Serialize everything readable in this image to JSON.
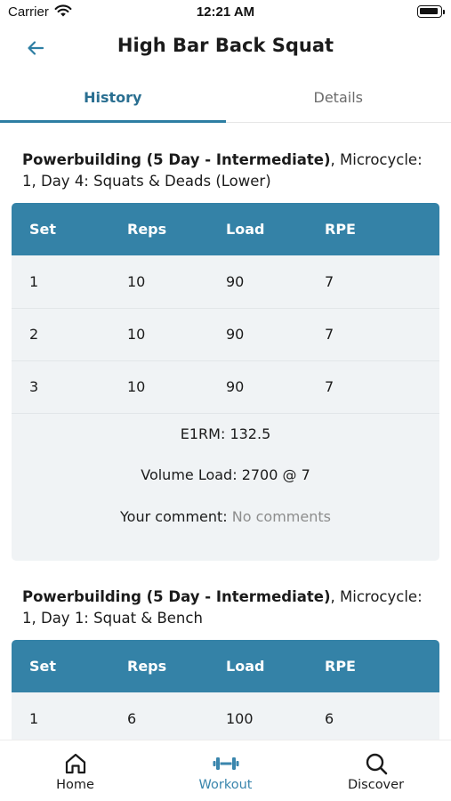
{
  "status_bar": {
    "carrier": "Carrier",
    "time": "12:21 AM"
  },
  "header": {
    "title": "High Bar Back Squat"
  },
  "tabs": [
    {
      "label": "History",
      "active": true
    },
    {
      "label": "Details",
      "active": false
    }
  ],
  "table_headers": [
    "Set",
    "Reps",
    "Load",
    "RPE"
  ],
  "sessions": [
    {
      "program": "Powerbuilding (5 Day - Intermediate)",
      "details": ", Microcycle: 1, Day 4: Squats & Deads (Lower)",
      "rows": [
        [
          "1",
          "10",
          "90",
          "7"
        ],
        [
          "2",
          "10",
          "90",
          "7"
        ],
        [
          "3",
          "10",
          "90",
          "7"
        ]
      ],
      "e1rm": "E1RM: 132.5",
      "volume_load": "Volume Load: 2700 @ 7",
      "comment_label": "Your comment: ",
      "comment_value": "No comments"
    },
    {
      "program": "Powerbuilding (5 Day - Intermediate)",
      "details": ", Microcycle: 1, Day 1: Squat & Bench",
      "rows": [
        [
          "1",
          "6",
          "100",
          "6"
        ]
      ]
    }
  ],
  "bottom_nav": [
    {
      "label": "Home",
      "icon": "home-icon",
      "active": false
    },
    {
      "label": "Workout",
      "icon": "dumbbell-icon",
      "active": true
    },
    {
      "label": "Discover",
      "icon": "search-icon",
      "active": false
    }
  ],
  "colors": {
    "accent": "#3482a7",
    "active_tab": "#2a6f91",
    "card_bg": "#f0f3f5",
    "muted": "#8d8d8d"
  }
}
